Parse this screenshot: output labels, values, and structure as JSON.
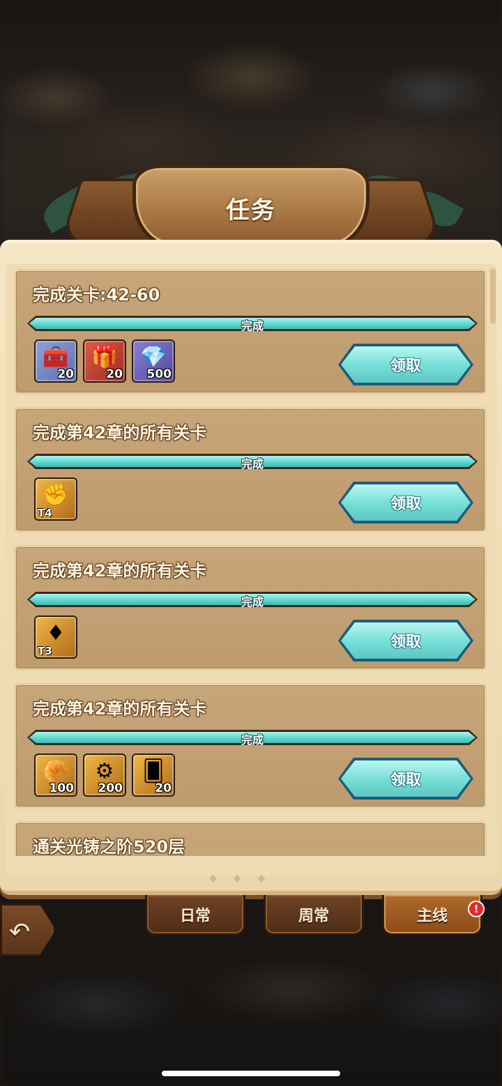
{
  "header": {
    "title": "任务"
  },
  "progress_label": "完成",
  "claim_label": "领取",
  "tasks": [
    {
      "title": "完成关卡:42-60",
      "progress": 1.0,
      "rewards": [
        {
          "icon": "silver-chest-icon",
          "qty": "20",
          "bg": "blue"
        },
        {
          "icon": "gold-chest-icon",
          "qty": "20",
          "bg": "red"
        },
        {
          "icon": "diamond-icon",
          "qty": "500",
          "bg": "purple"
        }
      ]
    },
    {
      "title": "完成第42章的所有关卡",
      "progress": 1.0,
      "rewards": [
        {
          "icon": "red-gem-t4-icon",
          "tier": "T4",
          "bg": "gold"
        }
      ]
    },
    {
      "title": "完成第42章的所有关卡",
      "progress": 1.0,
      "rewards": [
        {
          "icon": "red-gem-t3-icon",
          "tier": "T3",
          "bg": "gold"
        }
      ]
    },
    {
      "title": "完成第42章的所有关卡",
      "progress": 1.0,
      "rewards": [
        {
          "icon": "gold-pile-icon",
          "qty": "100",
          "bg": "gold"
        },
        {
          "icon": "gear-medal-icon",
          "qty": "200",
          "bg": "gold"
        },
        {
          "icon": "card-icon",
          "qty": "20",
          "bg": "gold"
        }
      ]
    },
    {
      "title": "通关光铸之阶520层"
    }
  ],
  "tabs": [
    {
      "label": "日常",
      "active": false
    },
    {
      "label": "周常",
      "active": false
    },
    {
      "label": "主线",
      "active": true,
      "badge": "!"
    }
  ],
  "colors": {
    "accent": "#5fd9d0",
    "panel": "#efdcb4",
    "card": "#c2a073",
    "tab_active": "#b06a2a"
  }
}
